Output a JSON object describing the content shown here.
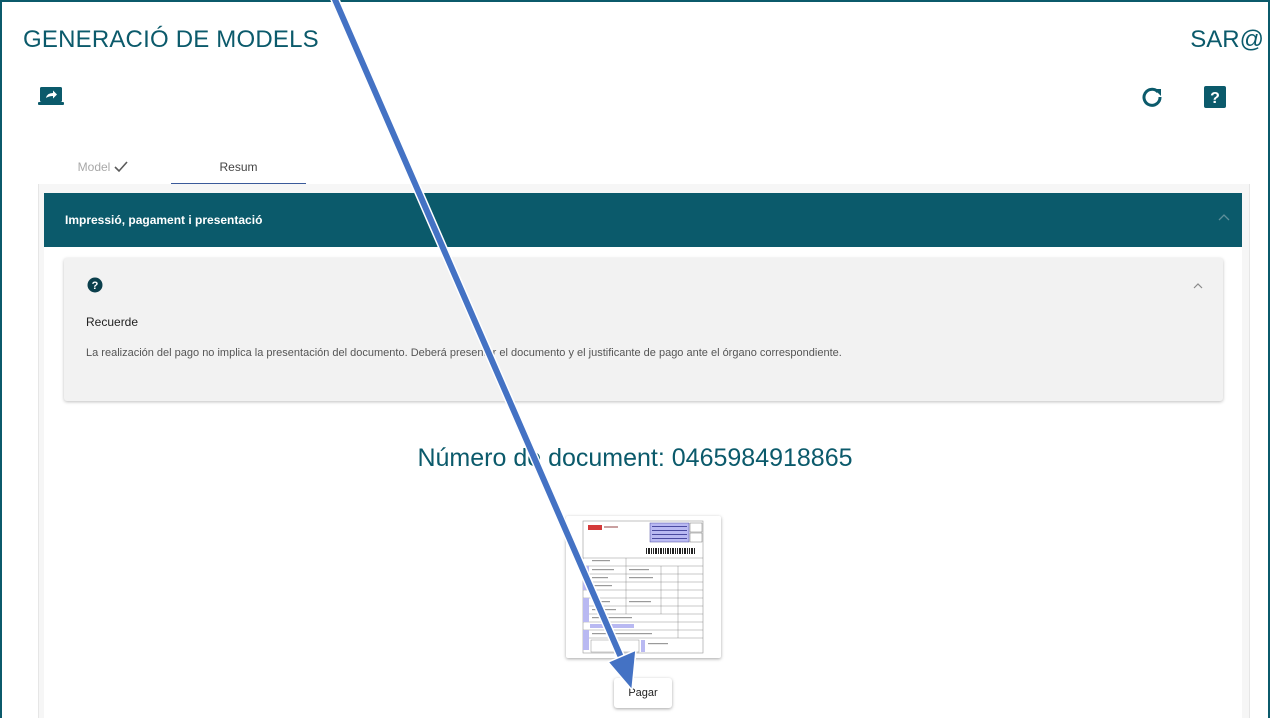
{
  "header": {
    "title": "GENERACIÓ DE MODELS",
    "brand": "SAR@"
  },
  "toolbar": {
    "share_icon": "share-screen-icon",
    "refresh_icon": "refresh-icon",
    "help_icon": "help-icon"
  },
  "tabs": [
    {
      "label": "Model",
      "completed": true
    },
    {
      "label": "Resum",
      "active": true
    }
  ],
  "panel": {
    "title": "Impressió, pagament i presentació"
  },
  "info": {
    "title": "Recuerde",
    "text": "La realización del pago no implica la presentación del documento. Deberá presentar el documento y el justificante de pago ante el órgano correspondiente."
  },
  "document": {
    "number_label": "Número de document: 0465984918865"
  },
  "actions": {
    "pay_label": "Pagar"
  },
  "colors": {
    "primary": "#0b5a6b",
    "tab_indicator": "#3a5a9a",
    "annotation_arrow": "#4472c4"
  }
}
